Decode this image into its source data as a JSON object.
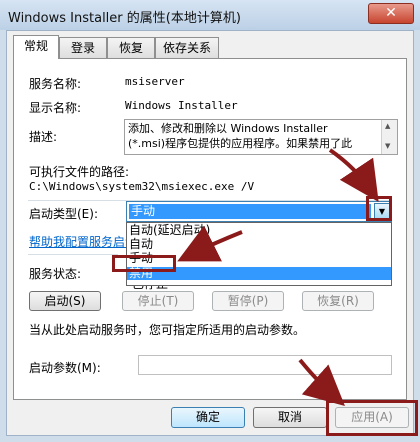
{
  "window": {
    "title": "Windows Installer 的属性(本地计算机)",
    "close_glyph": "✕"
  },
  "tabs": [
    "常规",
    "登录",
    "恢复",
    "依存关系"
  ],
  "general": {
    "service_name_label": "服务名称:",
    "service_name": "msiserver",
    "display_name_label": "显示名称:",
    "display_name": "Windows Installer",
    "description_label": "描述:",
    "description": "添加、修改和删除以 Windows Installer\n(*.msi)程序包提供的应用程序。如果禁用了此",
    "exe_path_label": "可执行文件的路径:",
    "exe_path": "C:\\Windows\\system32\\msiexec.exe /V",
    "startup_type_label": "启动类型(E):",
    "startup_type_value": "手动",
    "startup_options": [
      "自动(延迟启动)",
      "自动",
      "手动",
      "禁用"
    ],
    "startup_selected_option": "禁用",
    "help_link": "帮助我配置服务启动",
    "status_label": "服务状态:",
    "status_value": "已停止",
    "buttons": {
      "start": "启动(S)",
      "stop": "停止(T)",
      "pause": "暂停(P)",
      "resume": "恢复(R)"
    },
    "hint": "当从此处启动服务时，您可指定所适用的启动参数。",
    "params_label": "启动参数(M):",
    "params_value": ""
  },
  "footer": {
    "ok": "确定",
    "cancel": "取消",
    "apply": "应用(A)"
  },
  "colors": {
    "annotation": "#8b1a1a",
    "selection": "#3399ff"
  }
}
